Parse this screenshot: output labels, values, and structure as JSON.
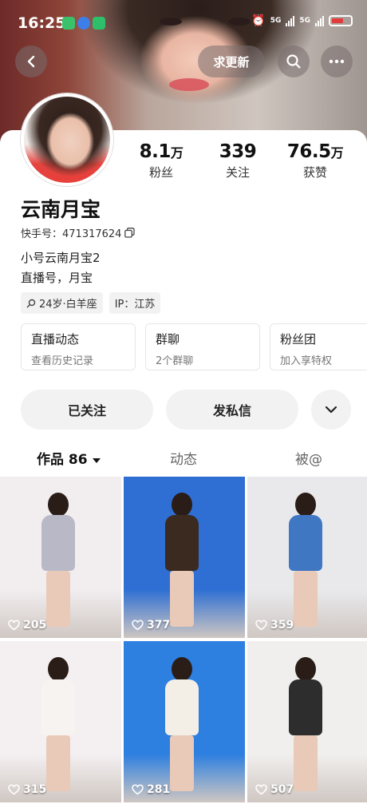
{
  "status_bar": {
    "time": "16:25",
    "network_label_1": "5G",
    "network_label_2": "5G"
  },
  "nav": {
    "back_icon": "chevron-left-icon",
    "update_button": "求更新",
    "search_icon": "search-icon",
    "more_icon": "more-icon"
  },
  "profile": {
    "name": "云南月宝",
    "kuaishou_id": "快手号：471317624",
    "bio_line_1": "小号云南月宝2",
    "bio_line_2": "直播号，月宝",
    "tag_age": "24岁·白羊座",
    "tag_ip": "IP：江苏"
  },
  "stats": [
    {
      "value": "8.1",
      "unit": "万",
      "label": "粉丝"
    },
    {
      "value": "339",
      "unit": "",
      "label": "关注"
    },
    {
      "value": "76.5",
      "unit": "万",
      "label": "获赞"
    }
  ],
  "features": [
    {
      "title": "直播动态",
      "subtitle": "查看历史记录"
    },
    {
      "title": "群聊",
      "subtitle": "2个群聊"
    },
    {
      "title": "粉丝团",
      "subtitle": "加入享特权"
    }
  ],
  "actions": {
    "followed": "已关注",
    "message": "发私信",
    "expand_icon": "chevron-down-icon"
  },
  "tabs": {
    "works": "作品 86",
    "moments": "动态",
    "mentioned": "被@"
  },
  "grid": [
    {
      "likes": "205",
      "bg": "#f2eef0",
      "outfit": "#b8b8c6"
    },
    {
      "likes": "377",
      "bg": "#2f6fd3",
      "outfit": "#3a2a20"
    },
    {
      "likes": "359",
      "bg": "#e9e9ec",
      "outfit": "#3f77c3"
    },
    {
      "likes": "315",
      "bg": "#f4f0f1",
      "outfit": "#f6f3f0"
    },
    {
      "likes": "281",
      "bg": "#2d7fe0",
      "outfit": "#f3efe6"
    },
    {
      "likes": "507",
      "bg": "#f1efee",
      "outfit": "#2d2d2d"
    }
  ]
}
